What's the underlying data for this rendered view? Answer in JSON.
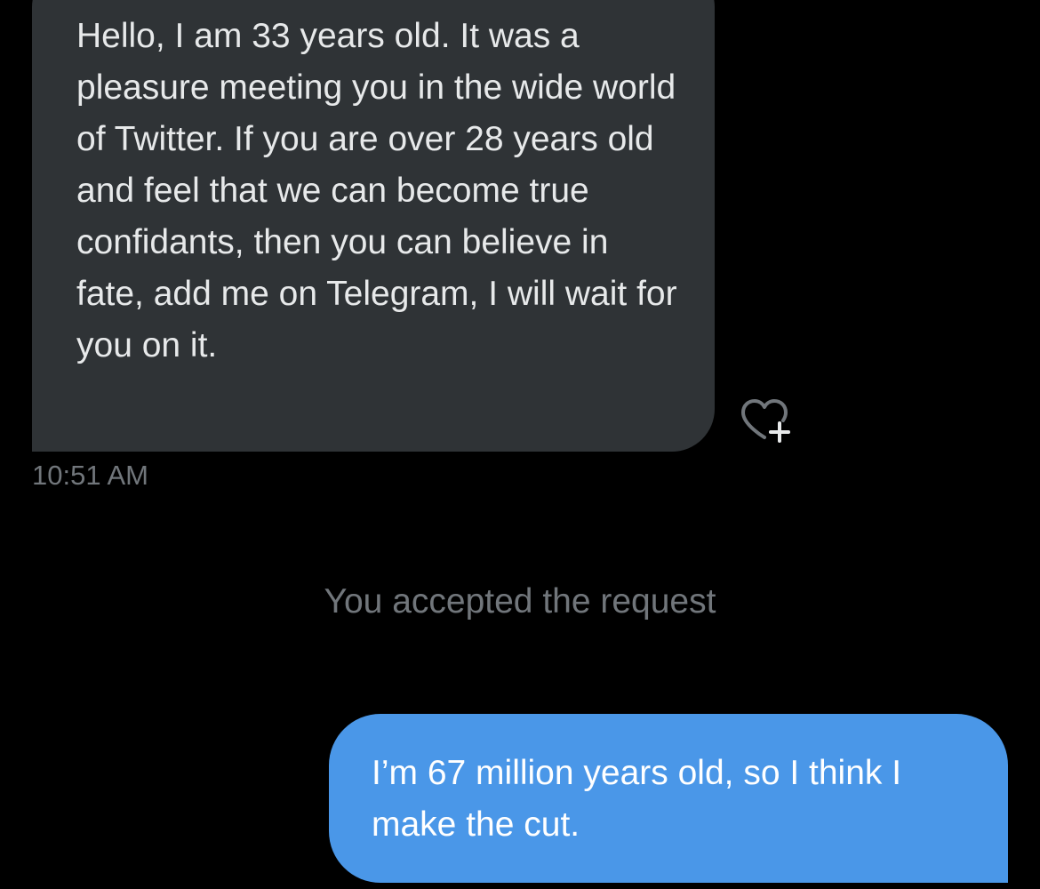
{
  "conversation": {
    "incoming_message": {
      "text": "Hello, I am 33 years old. It was a pleasure meeting you in the wide world of Twitter. If you are over 28 years old and feel that we can become true confidants, then you can believe in fate, add me on Telegram, I will wait for you on it.",
      "timestamp": "10:51 AM",
      "reaction_icon": "heart-plus-icon"
    },
    "system_notice": "You accepted the request",
    "outgoing_message": {
      "text": "I’m 67 million years old, so I think I make the cut."
    }
  },
  "colors": {
    "background": "#000000",
    "incoming_bubble": "#2f3336",
    "outgoing_bubble": "#4a97e8",
    "muted_text": "#71767b",
    "incoming_text": "#e7e9ea"
  }
}
